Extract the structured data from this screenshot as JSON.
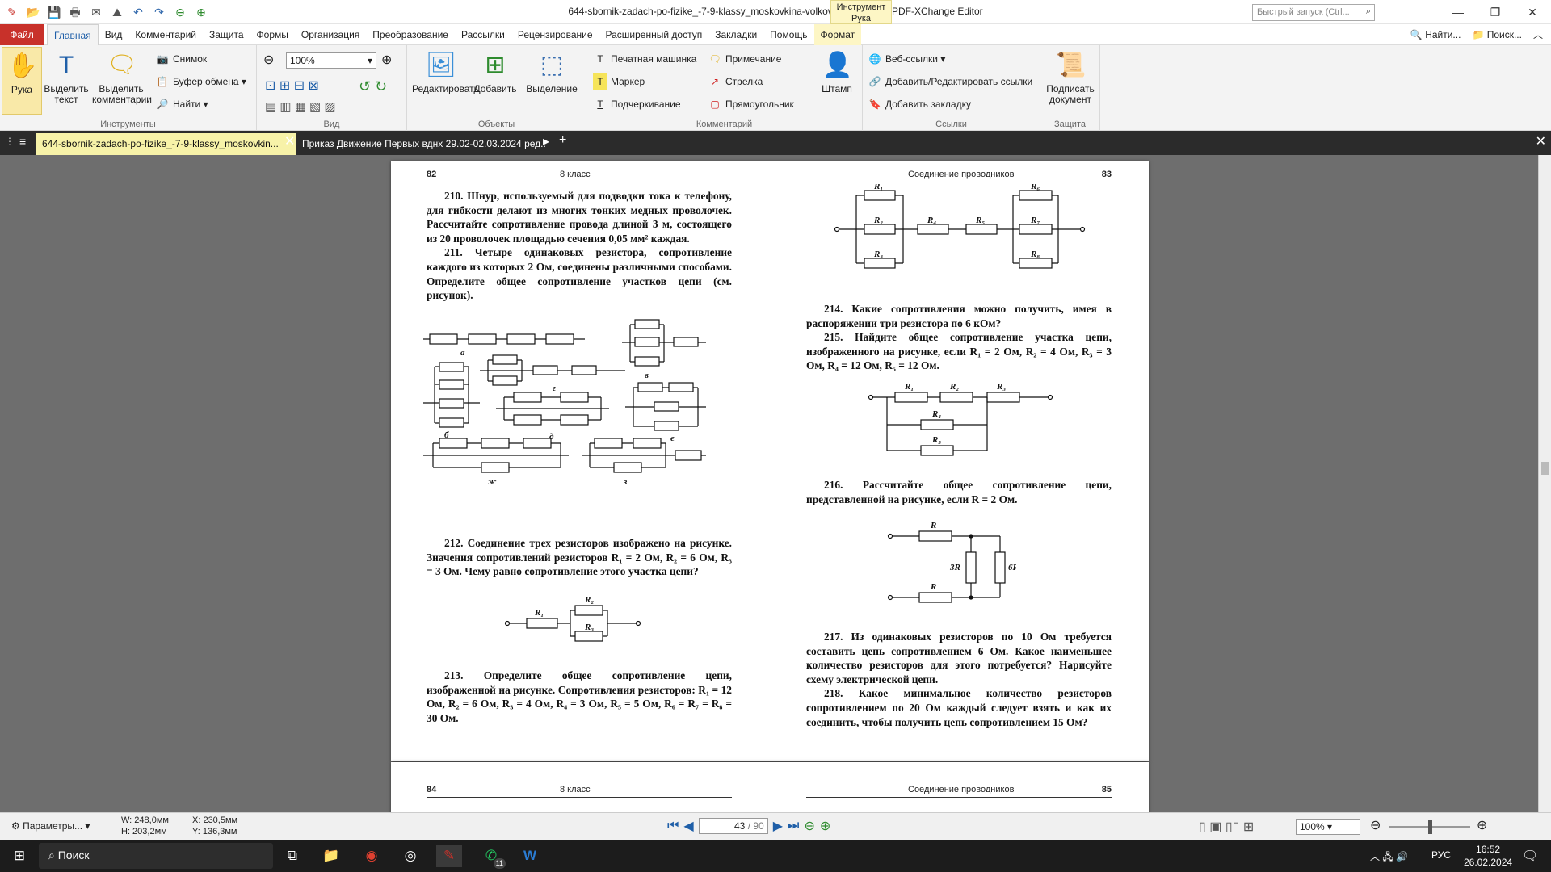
{
  "app": {
    "title": "644-sbornik-zadach-po-fizike_-7-9-klassy_moskovkina-volkov_2011-176s - PDF-XChange Editor",
    "context_tab": "Инструмент Рука",
    "quick_launch_placeholder": "Быстрый запуск (Ctrl...",
    "accent": "#c8312a"
  },
  "menu": {
    "file": "Файл",
    "items": [
      "Главная",
      "Вид",
      "Комментарий",
      "Защита",
      "Формы",
      "Организация",
      "Преобразование",
      "Рассылки",
      "Рецензирование",
      "Расширенный доступ",
      "Закладки",
      "Помощь",
      "Формат"
    ],
    "right": [
      "Найти...",
      "Поиск..."
    ]
  },
  "ribbon": {
    "tools": {
      "hand": "Рука",
      "select_text": "Выделить текст",
      "select_comments": "Выделить комментарии",
      "snapshot": "Снимок",
      "clipboard": "Буфер обмена",
      "find": "Найти",
      "label": "Инструменты"
    },
    "view": {
      "zoom": "100%",
      "label": "Вид"
    },
    "objects": {
      "edit": "Редактировать",
      "add": "Добавить",
      "select": "Выделение",
      "label": "Объекты"
    },
    "comments": {
      "typewriter": "Печатная машинка",
      "note": "Примечание",
      "marker": "Маркер",
      "arrow": "Стрелка",
      "underline": "Подчеркивание",
      "rect": "Прямоугольник",
      "stamp": "Штамп",
      "label": "Комментарий"
    },
    "links": {
      "web": "Веб-ссылки",
      "addedit": "Добавить/Редактировать ссылки",
      "bookmark": "Добавить закладку",
      "label": "Ссылки"
    },
    "protect": {
      "sign": "Подписать документ",
      "label": "Защита"
    }
  },
  "tabs": [
    {
      "label": "644-sbornik-zadach-po-fizike_-7-9-klassy_moskovkin..."
    },
    {
      "label": "Приказ Движение Первых вднх 29.02-02.03.2024 ред.."
    }
  ],
  "page_left": {
    "num": "82",
    "section": "8 класс",
    "p210": "210. Шнур, используемый для подводки тока к телефону, для гибкости делают из многих тонких медных проволочек. Рассчитайте сопротивление провода длиной 3 м, состоящего из 20 проволочек площадью сечения 0,05 мм² каждая.",
    "p211": "211. Четыре одинаковых резистора, сопротивление каждого из которых 2 Ом, соединены различными способами. Определите общее сопротивление участков цепи (см. рисунок).",
    "p212": "212. Соединение трех резисторов изображено на рисунке. Значения сопротивлений резисторов R₁ = 2 Ом, R₂ = 6 Ом, R₃ = 3 Ом. Чему равно сопротивление этого участка цепи?",
    "p213": "213. Определите общее сопротивление цепи, изображенной на рисунке. Сопротивления резисторов: R₁ = 12 Ом, R₂ = 6 Ом, R₃ = 4 Ом, R₄ = 3 Ом, R₅ = 5 Ом, R₆ = R₇ = R₈ = 30 Ом.",
    "fig_labels": [
      "а",
      "б",
      "в",
      "г",
      "д",
      "е",
      "ж",
      "з"
    ]
  },
  "page_right": {
    "num": "83",
    "section": "Соединение проводников",
    "p214": "214. Какие сопротивления можно получить, имея в распоряжении три резистора по 6 кОм?",
    "p215": "215. Найдите общее сопротивление участка цепи, изображенного на рисунке, если R₁ = 2 Ом, R₂ = 4 Ом, R₃ = 3 Ом, R₄ = 12 Ом, R₅ = 12 Ом.",
    "p216": "216. Рассчитайте общее сопротивление цепи, представленной на рисунке, если R = 2 Ом.",
    "p217": "217. Из одинаковых резисторов по 10 Ом требуется составить цепь сопротивлением 6 Ом. Какое наименьшее количество резисторов для этого потребуется? Нарисуйте схему электрической цепи.",
    "p218": "218. Какое минимальное количество резисторов сопротивлением по 20 Ом каждый следует взять и как их соединить, чтобы получить цепь сопротивлением 15 Ом?"
  },
  "page_next": {
    "left_num": "84",
    "left_section": "8 класс",
    "right_section": "Соединение проводников",
    "right_num": "85"
  },
  "status": {
    "params": "Параметры...",
    "w": "W: 248,0мм",
    "h": "H: 203,2мм",
    "x": "X: 230,5мм",
    "y": "Y: 136,3мм",
    "page": "43",
    "total": "/ 90",
    "zoom": "100%"
  },
  "taskbar": {
    "search": "Поиск",
    "lang": "РУС",
    "time": "16:52",
    "date": "26.02.2024",
    "whatsapp_badge": "11"
  }
}
